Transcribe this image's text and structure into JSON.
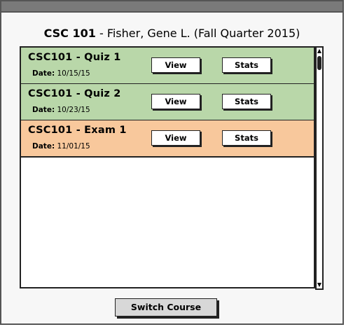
{
  "header": {
    "course_code": "CSC 101",
    "course_rest": " - Fisher, Gene L. (Fall Quarter 2015)"
  },
  "assessments": [
    {
      "title": "CSC101 - Quiz 1",
      "date_label": "Date:",
      "date": "10/15/15",
      "view_label": "View",
      "stats_label": "Stats",
      "color": "#b9d7a9"
    },
    {
      "title": "CSC101 - Quiz 2",
      "date_label": "Date:",
      "date": "10/23/15",
      "view_label": "View",
      "stats_label": "Stats",
      "color": "#b9d7a9"
    },
    {
      "title": "CSC101 - Exam 1",
      "date_label": "Date:",
      "date": "11/01/15",
      "view_label": "View",
      "stats_label": "Stats",
      "color": "#f8c89c"
    }
  ],
  "scrollbar": {
    "up_icon": "triangle-up-icon",
    "down_icon": "triangle-down-icon"
  },
  "footer": {
    "switch_label": "Switch Course"
  }
}
